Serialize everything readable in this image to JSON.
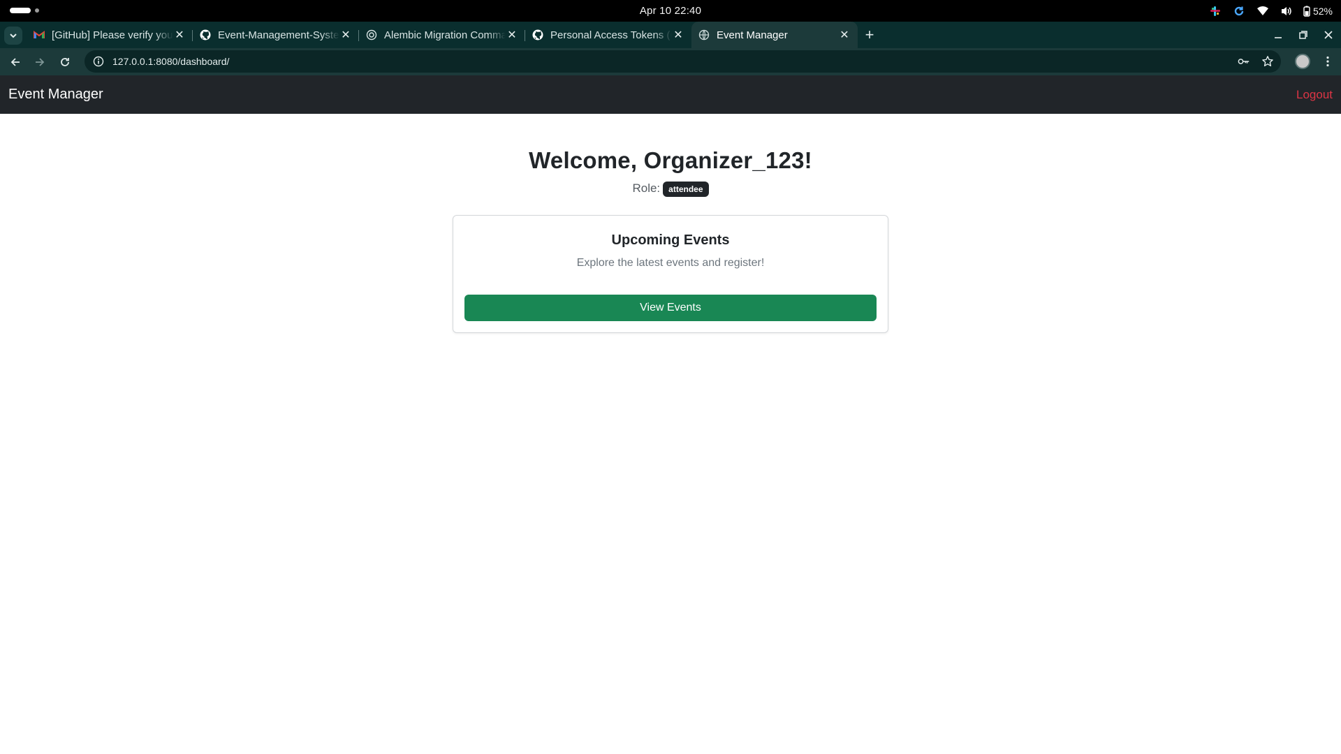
{
  "os": {
    "clock": "Apr 10  22:40",
    "battery": "52%"
  },
  "browser": {
    "tabs": [
      {
        "title": "[GitHub] Please verify your device",
        "icon": "gmail-icon",
        "active": false
      },
      {
        "title": "Event-Management-System",
        "icon": "github-icon",
        "active": false
      },
      {
        "title": "Alembic Migration Commands",
        "icon": "globe-icon",
        "active": false
      },
      {
        "title": "Personal Access Tokens (Classic)",
        "icon": "github-icon",
        "active": false
      },
      {
        "title": "Event Manager",
        "icon": "globe-icon",
        "active": true
      }
    ],
    "url": "127.0.0.1:8080/dashboard/"
  },
  "app": {
    "brand": "Event Manager",
    "logout": "Logout",
    "welcome": "Welcome, Organizer_123!",
    "role_label": "Role:",
    "role_value": "attendee",
    "card": {
      "title": "Upcoming Events",
      "text": "Explore the latest events and register!",
      "button": "View Events"
    }
  },
  "colors": {
    "navbar": "#212529",
    "logout": "#dc3545",
    "button": "#198754",
    "tabstrip": "#0a2e2e"
  }
}
